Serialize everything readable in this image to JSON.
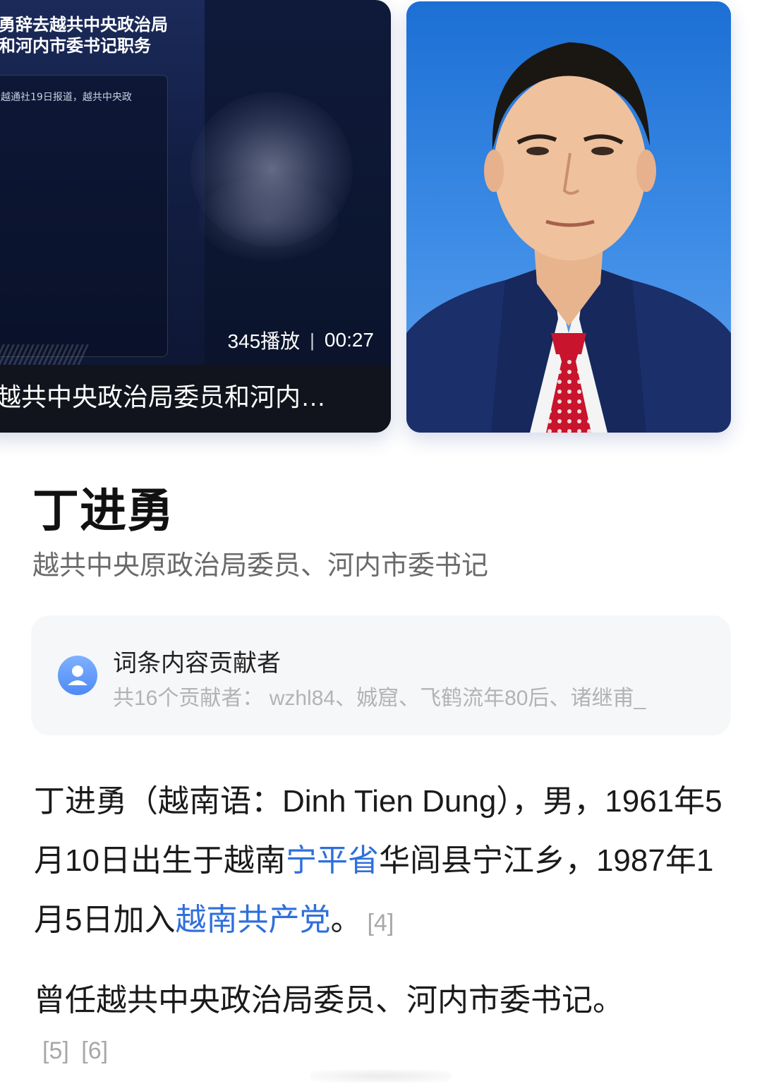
{
  "video": {
    "headline_line1": "勇辞去越共中央政治局",
    "headline_line2": "和河内市委书记职务",
    "inner_text": "越通社19日报道，越共中央政",
    "play_count": "345播放",
    "separator": "|",
    "duration": "00:27",
    "title": "越共中央政治局委员和河内…"
  },
  "portrait": {
    "icon": "person-portrait",
    "colors": {
      "background": "#2a7fe0",
      "suit": "#1b2f6b",
      "tie": "#c8142c"
    }
  },
  "person": {
    "name": "丁进勇",
    "subtitle": "越共中央原政治局委员、河内市委书记"
  },
  "contributors": {
    "title": "词条内容贡献者",
    "list": "共16个贡献者：  wzhl84、娍窟、飞鹤流年80后、诸继甫_"
  },
  "body": {
    "p1_a": "丁进勇（越南语：Dinh Tien Dung），男，1961年5月10日出生于越南",
    "p1_link1": "宁平省",
    "p1_b": "华闾县宁江乡，1987年1月5日加入",
    "p1_link2": "越南共产党",
    "p1_c": "。",
    "p1_ref": "[4]",
    "p2": "曾任越共中央政治局委员、河内市委书记。",
    "p2_refs": [
      "[5]",
      "[6]"
    ]
  },
  "colors": {
    "link": "#2f6fdc",
    "muted": "#a8a8a8"
  }
}
